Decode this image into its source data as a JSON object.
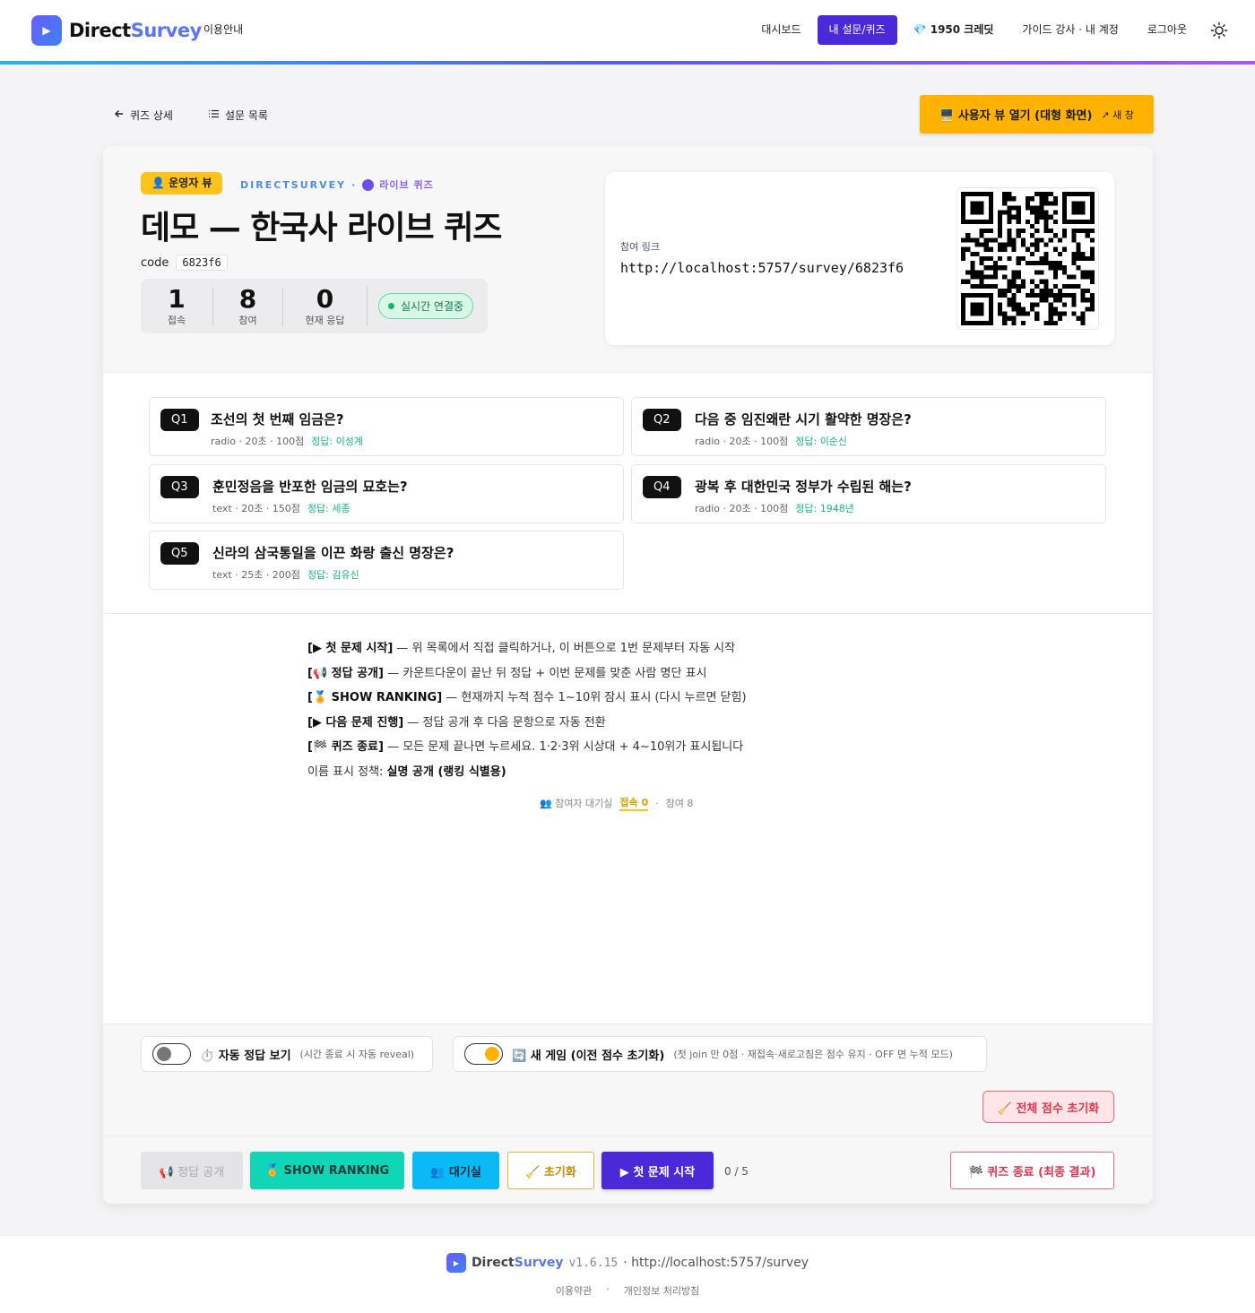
{
  "header": {
    "brand_a": "Direct",
    "brand_b": "Survey",
    "guide": "이용안내",
    "nav": {
      "dashboard": "대시보드",
      "my_surveys": "내 설문/퀴즈",
      "credits": "1950 크레딧",
      "account": "가이드 강사 · 내 계정",
      "logout": "로그아웃"
    },
    "colors": {
      "active": "#4b28d8",
      "accent_bar": "#5a5af0"
    }
  },
  "toprow": {
    "back": "퀴즈 상세",
    "list": "설문 목록",
    "user_view": "🖥️ 사용자 뷰 열기 (대형 화면)",
    "user_view_sub": "↗ 새 창"
  },
  "hero": {
    "badge": "👤 운영자 뷰",
    "brand_tag": "DIRECTSURVEY",
    "brand_sep": "·",
    "live_tag": "라이브 퀴즈",
    "title": "데모 — 한국사 라이브 퀴즈",
    "code_label": "code",
    "code": "6823f6",
    "stats": [
      {
        "n": "1",
        "l": "접속"
      },
      {
        "n": "8",
        "l": "참여"
      },
      {
        "n": "0",
        "l": "현재 응답"
      }
    ],
    "live_status": "실시간 연결중"
  },
  "share": {
    "label": "참여 링크",
    "url": "http://localhost:5757/survey/6823f6"
  },
  "questions": [
    {
      "num": "Q1",
      "title": "조선의 첫 번째 임금은?",
      "meta": "radio · 20초 · 100점",
      "answer": "정답: 이성계"
    },
    {
      "num": "Q2",
      "title": "다음 중 임진왜란 시기 활약한 명장은?",
      "meta": "radio · 20초 · 100점",
      "answer": "정답: 이순신"
    },
    {
      "num": "Q3",
      "title": "훈민정음을 반포한 임금의 묘호는?",
      "meta": "text · 20초 · 150점",
      "answer": "정답: 세종"
    },
    {
      "num": "Q4",
      "title": "광복 후 대한민국 정부가 수립된 해는?",
      "meta": "radio · 20초 · 100점",
      "answer": "정답: 1948년"
    },
    {
      "num": "Q5",
      "title": "신라의 삼국통일을 이끈 화랑 출신 명장은?",
      "meta": "text · 25초 · 200점",
      "answer": "정답: 김유신"
    }
  ],
  "instructions": [
    {
      "key": "[▶ 첫 문제 시작]",
      "desc": " — 위 목록에서 직접 클릭하거나, 이 버튼으로 1번 문제부터 자동 시작"
    },
    {
      "key": "[📢 정답 공개]",
      "desc": " — 카운트다운이 끝난 뒤 정답 + 이번 문제를 맞춘 사람 명단 표시"
    },
    {
      "key": "[🏅 SHOW RANKING]",
      "desc": " — 현재까지 누적 점수 1~10위 잠시 표시 (다시 누르면 닫힘)"
    },
    {
      "key": "[▶ 다음 문제 진행]",
      "desc": " — 정답 공개 후 다음 문항으로 자동 전환"
    },
    {
      "key": "[🏁 퀴즈 종료]",
      "desc": " — 모든 문제 끝나면 누르세요. 1·2·3위 시상대 + 4~10위가 표시됩니다"
    }
  ],
  "name_policy": {
    "label": "이름 표시 정책: ",
    "value": "실명 공개 (랭킹 식별용)"
  },
  "waiting": {
    "label": "👥 참여자 대기실",
    "connected": "접속 0",
    "sep": "·",
    "joined": "참여 8"
  },
  "toggles": {
    "auto_reveal": {
      "label": "⏱️ 자동 정답 보기",
      "hint": "(시간 종료 시 자동 reveal)",
      "on": false
    },
    "new_game": {
      "label": "🔄 새 게임 (이전 점수 초기화)",
      "hint": "(첫 join 만 0점 · 재접속·새로고침은 점수 유지 · OFF 면 누적 모드)",
      "on": true
    },
    "reset_all": "🧹 전체 점수 초기화"
  },
  "actions": {
    "reveal": "📢 정답 공개",
    "ranking": "🏅 SHOW RANKING",
    "lobby": "👥 대기실",
    "reset": "🧹 초기화",
    "start": "▶ 첫 문제 시작",
    "progress": "0 / 5",
    "end": "🏁 퀴즈 종료 (최종 결과)"
  },
  "footer": {
    "brand_a": "Direct",
    "brand_b": "Survey",
    "version": "v1.6.15",
    "url": "· http://localhost:5757/survey",
    "terms": "이용약관",
    "sep": "·",
    "privacy": "개인정보 처리방침"
  }
}
